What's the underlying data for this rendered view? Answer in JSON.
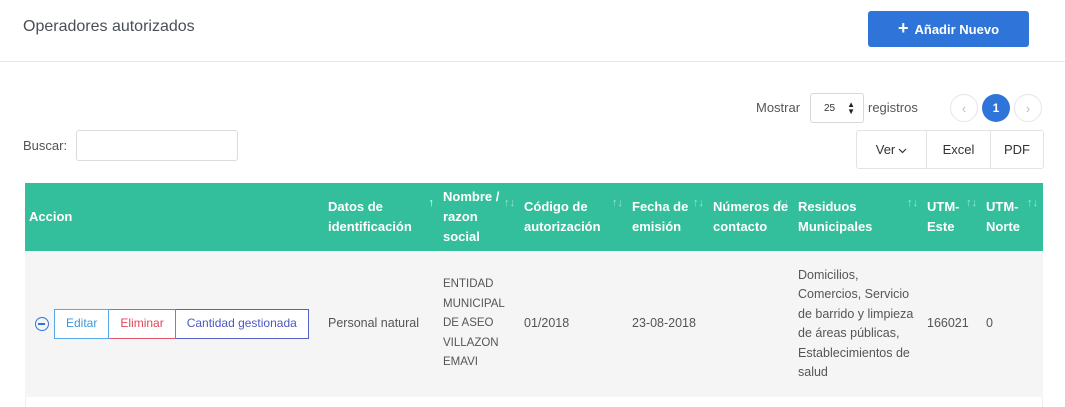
{
  "header": {
    "title": "Operadores autorizados",
    "add_button": "Añadir Nuevo"
  },
  "controls": {
    "show_label": "Mostrar",
    "page_size": "25",
    "records_label": "registros",
    "search_label": "Buscar:",
    "search_value": "",
    "pagination": {
      "prev": "‹",
      "current": "1",
      "next": "›"
    },
    "export": {
      "view": "Ver",
      "excel": "Excel",
      "pdf": "PDF"
    }
  },
  "table": {
    "columns": [
      "Accion",
      "Datos de identificación",
      "Nombre / razon social",
      "Código de autorización",
      "Fecha de emisión",
      "Números de contacto",
      "Residuos Municipales",
      "UTM-Este",
      "UTM-Norte"
    ],
    "sort_glyph": "↑↓",
    "sorted_column": 1,
    "actions": {
      "edit": "Editar",
      "delete": "Eliminar",
      "quantity": "Cantidad gestionada"
    },
    "rows": [
      {
        "identification": "Personal natural",
        "name": "ENTIDAD MUNICIPAL DE ASEO VILLAZON EMAVI",
        "authorization_code": "01/2018",
        "issue_date": "23-08-2018",
        "contact_numbers": "",
        "municipal_waste": "Domicilios, Comercios, Servicio de barrido y limpieza de áreas públicas, Establecimientos de salud",
        "utm_east": "166021",
        "utm_north": "0"
      }
    ]
  },
  "colors": {
    "accent": "#2f74d9",
    "table_header": "#33bf9b",
    "edit": "#3d97dc",
    "delete": "#df4657",
    "quantity": "#4b58c4"
  },
  "icons": [
    "plus-icon",
    "chevron-down-icon",
    "chevron-left-icon",
    "chevron-right-icon",
    "sort-icon",
    "collapse-row-icon",
    "select-caret-icon"
  ]
}
